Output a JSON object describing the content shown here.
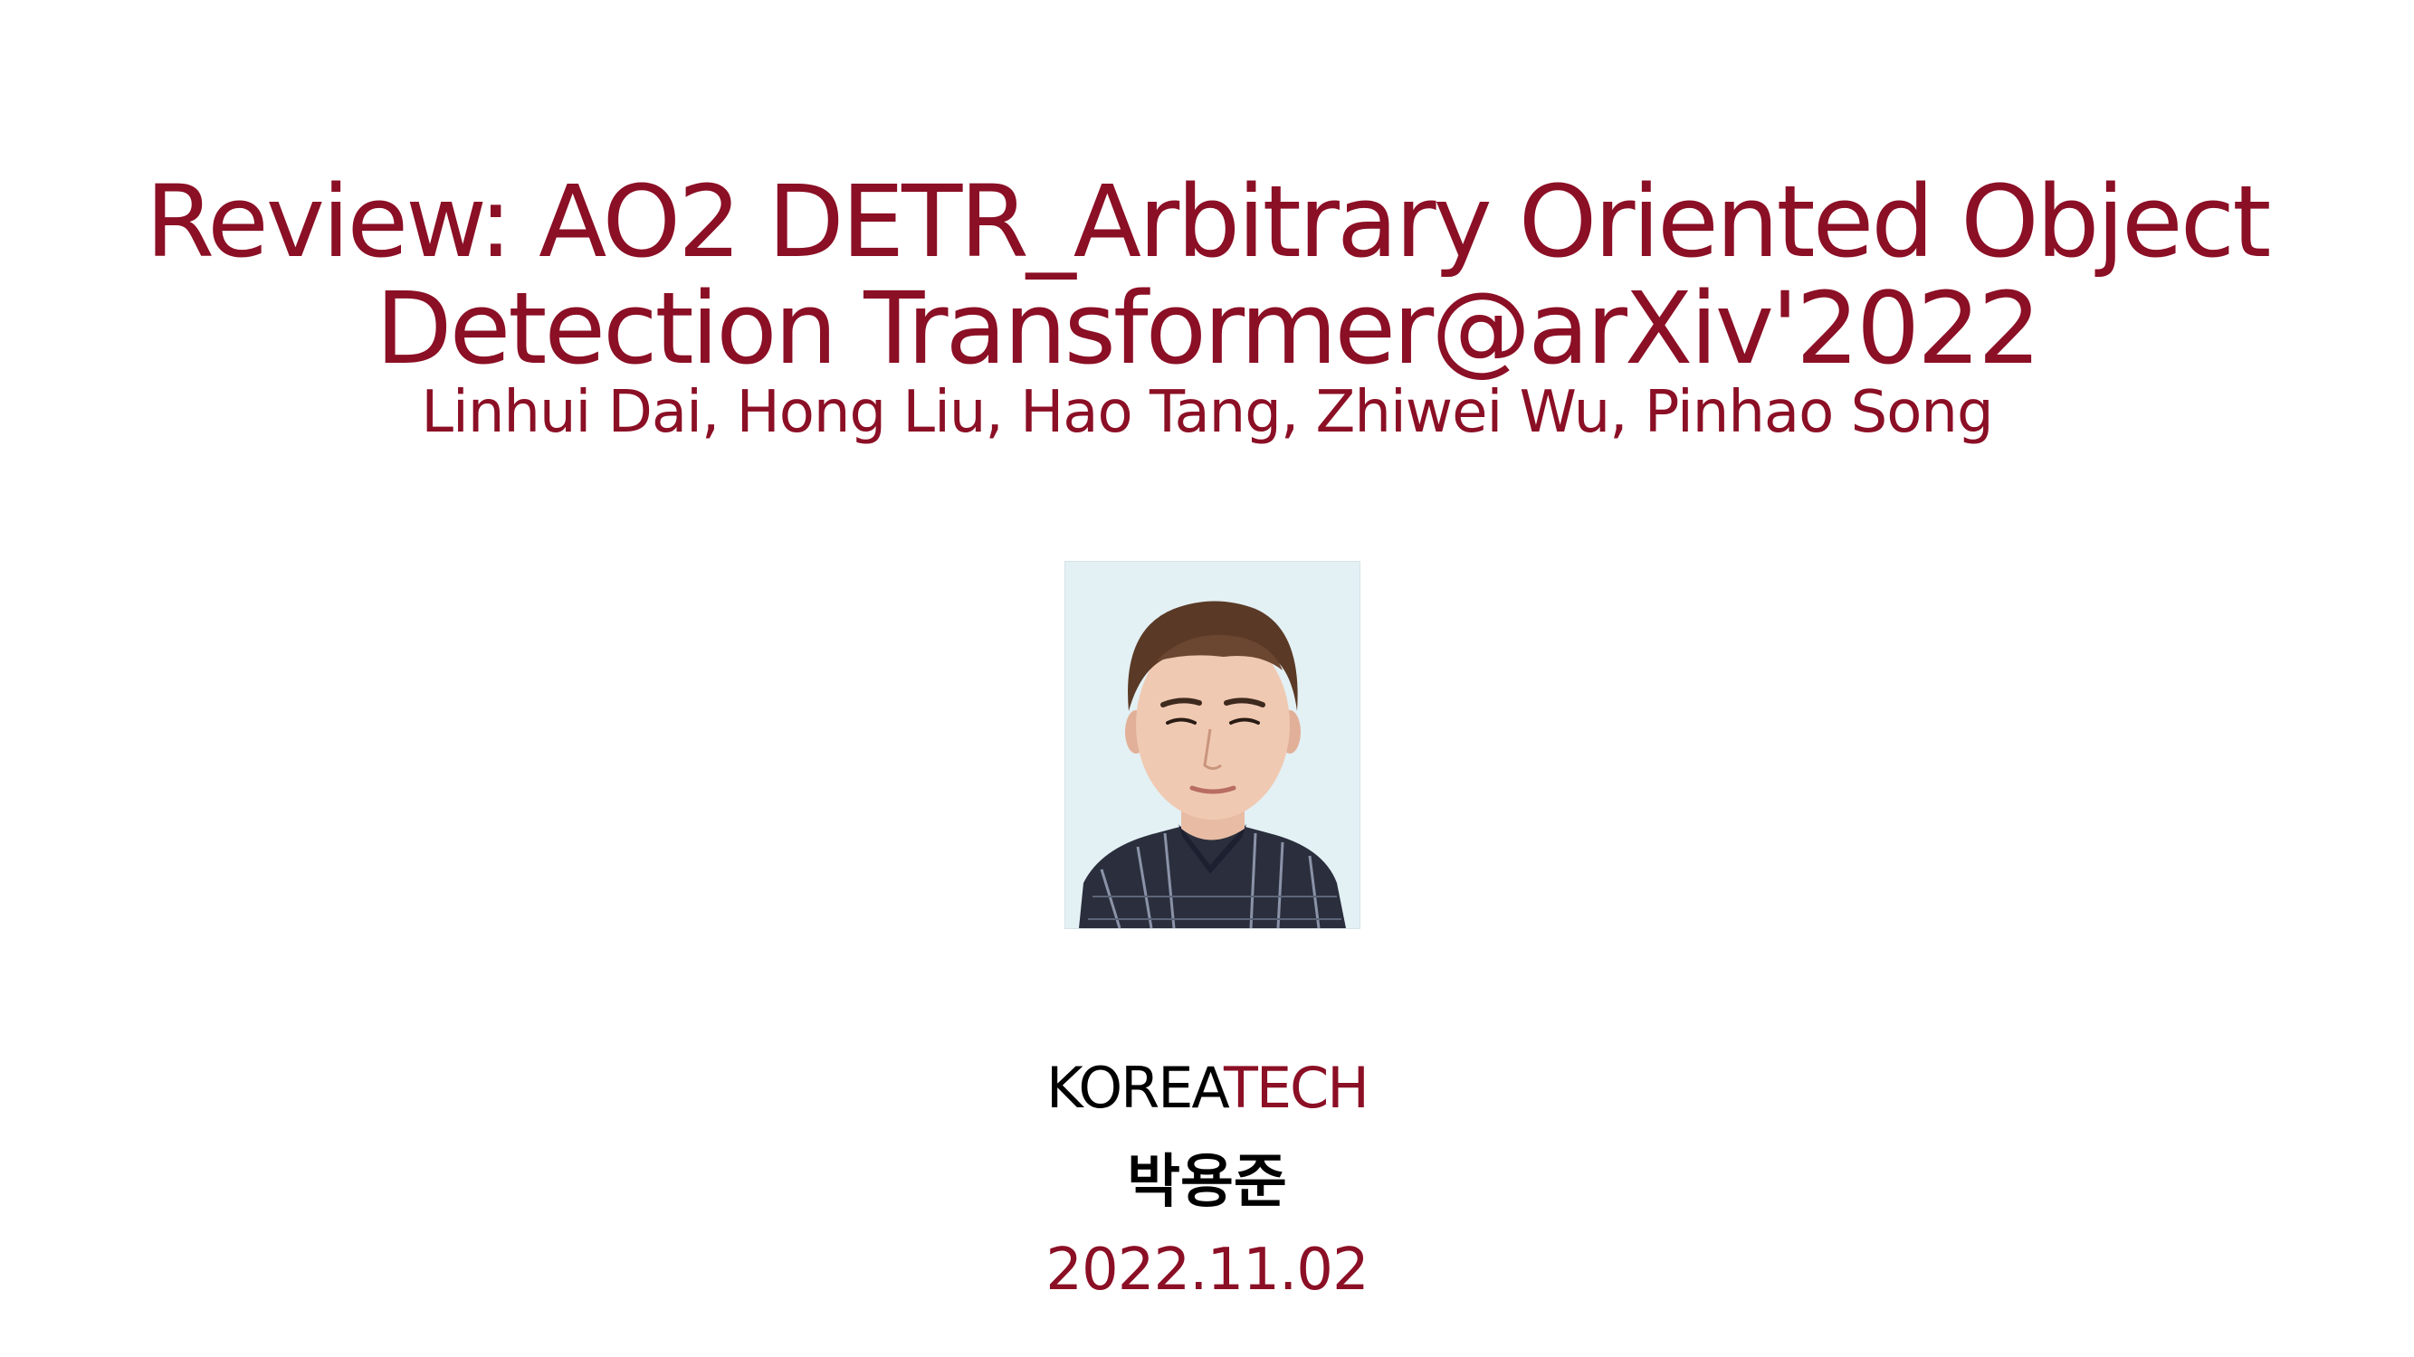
{
  "slide": {
    "title_line1": "Review: AO2 DETR_Arbitrary Oriented Object",
    "title_line2": "Detection Transformer@arXiv'2022",
    "authors": "Linhui Dai, Hong Liu, Hao Tang, Zhiwei Wu, Pinhao Song",
    "affiliation_part1": "KOREA",
    "affiliation_part2": "TECH",
    "presenter": "박용준",
    "date": "2022.11.02"
  },
  "colors": {
    "accent": "#8b0f25",
    "text": "#000000",
    "background": "#ffffff",
    "photo_background": "#e3f0f4"
  }
}
